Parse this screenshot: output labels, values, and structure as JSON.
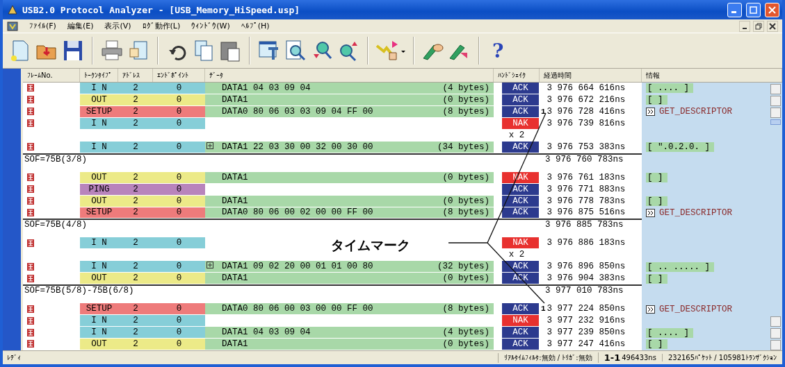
{
  "window": {
    "title": "USB2.0 Protocol Analyzer - [USB_Memory_HiSpeed.usp]"
  },
  "menu": [
    "ﾌｧｲﾙ(F)",
    "編集(E)",
    "表示(V)",
    "ﾛｸﾞ動作(L)",
    "ｳｨﾝﾄﾞｳ(W)",
    "ﾍﾙﾌﾟ(H)"
  ],
  "toolbar": {
    "help_label": "?"
  },
  "table": {
    "columns": [
      "ﾌﾚｰﾑNo.",
      "ﾄｰｸﾝﾀｲﾌﾟ",
      "ｱﾄﾞﾚｽ",
      "ｴﾝﾄﾞﾎﾟｲﾝﾄ",
      "ﾃﾞｰﾀ",
      "ﾊﾝﾄﾞｼｪｲｸ",
      "経過時間",
      "情報"
    ],
    "rows": [
      {
        "kind": "transaction",
        "token": {
          "text": "I N",
          "color": "#86ced8"
        },
        "address": "2",
        "endpoint": "0",
        "data": {
          "text": "DATA1 04 03 09 04",
          "size": "(4 bytes)",
          "expandable": false
        },
        "handshake": {
          "text": "ACK",
          "color": "#2c3a8e"
        },
        "time": "3 976 664 616ns",
        "info": {
          "kind": "bracket",
          "text": "[ .... ]"
        }
      },
      {
        "kind": "transaction",
        "token": {
          "text": "OUT",
          "color": "#ecea88"
        },
        "address": "2",
        "endpoint": "0",
        "data": {
          "text": "DATA1",
          "size": "(0 bytes)",
          "expandable": false
        },
        "handshake": {
          "text": "ACK",
          "color": "#2c3a8e"
        },
        "time": "3 976 672 216ns",
        "info": {
          "kind": "bracket",
          "text": "[ ]"
        }
      },
      {
        "kind": "transaction",
        "token": {
          "text": "SETUP",
          "color": "#ee7b7b"
        },
        "address": "2",
        "endpoint": "0",
        "data": {
          "text": "DATA0 80 06 03 03 09 04 FF 00",
          "size": "(8 bytes)",
          "expandable": false
        },
        "handshake": {
          "text": "ACK",
          "color": "#2c3a8e"
        },
        "mark": "1",
        "time": "3 976 728 416ns",
        "info": {
          "kind": "descriptor",
          "text": "GET_DESCRIPTOR"
        }
      },
      {
        "kind": "transaction",
        "token": {
          "text": "I N",
          "color": "#86ced8"
        },
        "address": "2",
        "endpoint": "0",
        "handshake": {
          "text": "NAK",
          "color": "#e8312f"
        },
        "time": "3 976 739 816ns"
      },
      {
        "kind": "repeat",
        "text": "x 2"
      },
      {
        "kind": "transaction",
        "token": {
          "text": "I N",
          "color": "#86ced8"
        },
        "address": "2",
        "endpoint": "0",
        "data": {
          "text": "DATA1 22 03 30 00 32 00 30 00",
          "size": "(34 bytes)",
          "expandable": true
        },
        "handshake": {
          "text": "ACK",
          "color": "#2c3a8e"
        },
        "time": "3 976 753 383ns",
        "info": {
          "kind": "bracket",
          "text": "[ \".0.2.0. ]"
        }
      },
      {
        "kind": "sof",
        "text": "SOF=75B(3/8)",
        "time": "3 976 760 783ns"
      },
      {
        "kind": "transaction",
        "token": {
          "text": "OUT",
          "color": "#ecea88"
        },
        "address": "2",
        "endpoint": "0",
        "data": {
          "text": "DATA1",
          "size": "(0 bytes)",
          "expandable": false
        },
        "handshake": {
          "text": "NAK",
          "color": "#e8312f"
        },
        "time": "3 976 761 183ns",
        "info": {
          "kind": "bracket",
          "text": "[ ]"
        }
      },
      {
        "kind": "transaction",
        "token": {
          "text": "PING",
          "color": "#b884bc"
        },
        "address": "2",
        "endpoint": "0",
        "handshake": {
          "text": "ACK",
          "color": "#2c3a8e"
        },
        "time": "3 976 771 883ns"
      },
      {
        "kind": "transaction",
        "token": {
          "text": "OUT",
          "color": "#ecea88"
        },
        "address": "2",
        "endpoint": "0",
        "data": {
          "text": "DATA1",
          "size": "(0 bytes)",
          "expandable": false
        },
        "handshake": {
          "text": "ACK",
          "color": "#2c3a8e"
        },
        "time": "3 976 778 783ns",
        "info": {
          "kind": "bracket",
          "text": "[ ]"
        }
      },
      {
        "kind": "transaction",
        "token": {
          "text": "SETUP",
          "color": "#ee7b7b"
        },
        "address": "2",
        "endpoint": "0",
        "data": {
          "text": "DATA0 80 06 00 02 00 00 FF 00",
          "size": "(8 bytes)",
          "expandable": false
        },
        "handshake": {
          "text": "ACK",
          "color": "#2c3a8e"
        },
        "time": "3 976 875 516ns",
        "info": {
          "kind": "descriptor",
          "text": "GET_DESCRIPTOR"
        }
      },
      {
        "kind": "sof",
        "text": "SOF=75B(4/8)",
        "time": "3 976 885 783ns"
      },
      {
        "kind": "transaction",
        "token": {
          "text": "I N",
          "color": "#86ced8"
        },
        "address": "2",
        "endpoint": "0",
        "handshake": {
          "text": "NAK",
          "color": "#e8312f"
        },
        "time": "3 976 886 183ns"
      },
      {
        "kind": "repeat",
        "text": "x 2"
      },
      {
        "kind": "transaction",
        "token": {
          "text": "I N",
          "color": "#86ced8"
        },
        "address": "2",
        "endpoint": "0",
        "data": {
          "text": "DATA1 09 02 20 00 01 01 00 80",
          "size": "(32 bytes)",
          "expandable": true
        },
        "handshake": {
          "text": "ACK",
          "color": "#2c3a8e"
        },
        "time": "3 976 896 850ns",
        "info": {
          "kind": "bracket",
          "text": "[ .. ..... ]"
        }
      },
      {
        "kind": "transaction",
        "token": {
          "text": "OUT",
          "color": "#ecea88"
        },
        "address": "2",
        "endpoint": "0",
        "data": {
          "text": "DATA1",
          "size": "(0 bytes)",
          "expandable": false
        },
        "handshake": {
          "text": "ACK",
          "color": "#2c3a8e"
        },
        "time": "3 976 904 383ns",
        "info": {
          "kind": "bracket",
          "text": "[ ]"
        }
      },
      {
        "kind": "sof",
        "text": "SOF=75B(5/8)-75B(6/8)",
        "time": "3 977 010 783ns"
      },
      {
        "kind": "transaction",
        "token": {
          "text": "SETUP",
          "color": "#ee7b7b"
        },
        "address": "2",
        "endpoint": "0",
        "data": {
          "text": "DATA0 80 06 00 03 00 00 FF 00",
          "size": "(8 bytes)",
          "expandable": false
        },
        "handshake": {
          "text": "ACK",
          "color": "#2c3a8e"
        },
        "mark": "1",
        "time": "3 977 224 850ns",
        "info": {
          "kind": "descriptor",
          "text": "GET_DESCRIPTOR"
        }
      },
      {
        "kind": "transaction",
        "token": {
          "text": "I N",
          "color": "#86ced8"
        },
        "address": "2",
        "endpoint": "0",
        "handshake": {
          "text": "NAK",
          "color": "#e8312f"
        },
        "time": "3 977 232 916ns"
      },
      {
        "kind": "transaction",
        "token": {
          "text": "I N",
          "color": "#86ced8"
        },
        "address": "2",
        "endpoint": "0",
        "data": {
          "text": "DATA1 04 03 09 04",
          "size": "(4 bytes)",
          "expandable": false
        },
        "handshake": {
          "text": "ACK",
          "color": "#2c3a8e"
        },
        "time": "3 977 239 850ns",
        "info": {
          "kind": "bracket",
          "text": "[ .... ]"
        }
      },
      {
        "kind": "transaction",
        "token": {
          "text": "OUT",
          "color": "#ecea88"
        },
        "address": "2",
        "endpoint": "0",
        "data": {
          "text": "DATA1",
          "size": "(0 bytes)",
          "expandable": false
        },
        "handshake": {
          "text": "ACK",
          "color": "#2c3a8e"
        },
        "time": "3 977 247 416ns",
        "info": {
          "kind": "bracket",
          "text": "[ ]"
        }
      }
    ]
  },
  "annotation": {
    "text": "タイムマーク"
  },
  "status_bar": {
    "state": "ﾚﾃﾞｨ",
    "filter": "ﾘｱﾙﾀｲﾑﾌｨﾙﾀ:無効 / ﾄﾘｶﾞ:無効",
    "range": "1-1",
    "duration": "496433ns",
    "counts": "232165ﾊﾟｹｯﾄ / 105981ﾄﾗﾝｻﾞｸｼｮﾝ"
  }
}
